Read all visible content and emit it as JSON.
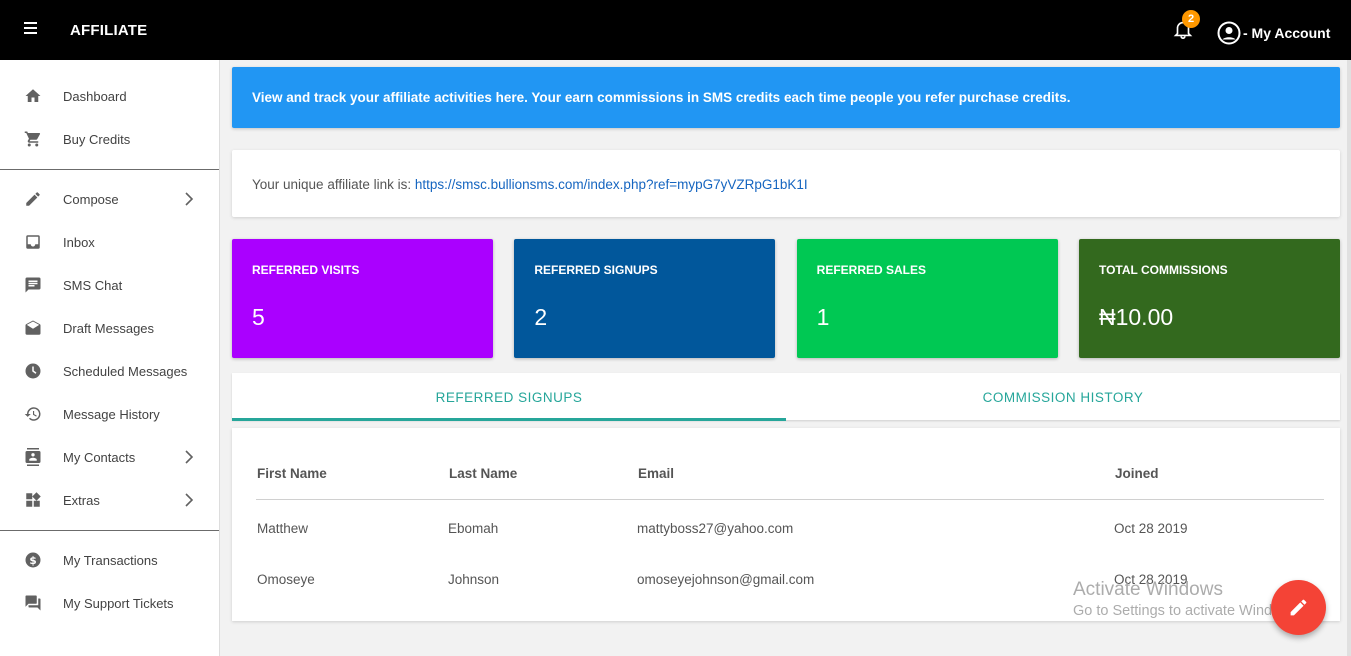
{
  "topbar": {
    "title": "AFFILIATE",
    "notification_count": "2",
    "account_label": "- My Account",
    "icons": {
      "menu": "hamburger-icon",
      "notifications": "bell-icon",
      "account": "account-circle-icon"
    }
  },
  "sidebar": {
    "groups": [
      [
        {
          "label": "Dashboard",
          "icon": "home-icon",
          "has_submenu": false
        },
        {
          "label": "Buy Credits",
          "icon": "cart-icon",
          "has_submenu": false
        }
      ],
      [
        {
          "label": "Compose",
          "icon": "pencil-icon",
          "has_submenu": true
        },
        {
          "label": "Inbox",
          "icon": "inbox-icon",
          "has_submenu": false
        },
        {
          "label": "SMS Chat",
          "icon": "chat-icon",
          "has_submenu": false
        },
        {
          "label": "Draft Messages",
          "icon": "drafts-icon",
          "has_submenu": false
        },
        {
          "label": "Scheduled Messages",
          "icon": "clock-icon",
          "has_submenu": false
        },
        {
          "label": "Message History",
          "icon": "history-icon",
          "has_submenu": false
        },
        {
          "label": "My Contacts",
          "icon": "contacts-icon",
          "has_submenu": true
        },
        {
          "label": "Extras",
          "icon": "widgets-icon",
          "has_submenu": true
        }
      ],
      [
        {
          "label": "My Transactions",
          "icon": "dollar-icon",
          "has_submenu": false
        },
        {
          "label": "My Support Tickets",
          "icon": "forum-icon",
          "has_submenu": false
        }
      ]
    ]
  },
  "info_banner": {
    "text": "View and track your affiliate activities here. Your earn commissions in SMS credits each time people you refer purchase credits.",
    "color": "#2196f3"
  },
  "affiliate_link": {
    "label": "Your unique affiliate link is: ",
    "url": "https://smsc.bullionsms.com/index.php?ref=mypG7yVZRpG1bK1I"
  },
  "stats": [
    {
      "title": "REFERRED VISITS",
      "value": "5",
      "color": "#aa00ff"
    },
    {
      "title": "REFERRED SIGNUPS",
      "value": "2",
      "color": "#01579b"
    },
    {
      "title": "REFERRED SALES",
      "value": "1",
      "color": "#00c853"
    },
    {
      "title": "TOTAL COMMISSIONS",
      "value": "₦10.00",
      "color": "#33691e"
    }
  ],
  "tabs": [
    {
      "label": "REFERRED SIGNUPS",
      "active": true
    },
    {
      "label": "COMMISSION HISTORY",
      "active": false
    }
  ],
  "table": {
    "columns": [
      "First Name",
      "Last Name",
      "Email",
      "Joined"
    ],
    "rows": [
      [
        "Matthew",
        "Ebomah",
        "mattyboss27@yahoo.com",
        "Oct 28 2019"
      ],
      [
        "Omoseye",
        "Johnson",
        "omoseyejohnson@gmail.com",
        "Oct 28 2019"
      ]
    ]
  },
  "watermark": {
    "line1": "Activate Windows",
    "line2": "Go to Settings to activate Windows."
  },
  "fab": {
    "icon": "pencil-icon",
    "color": "#f44336"
  },
  "accent_color": "#26a69a"
}
